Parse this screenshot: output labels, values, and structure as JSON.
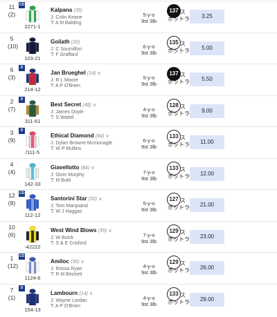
{
  "runners": [
    {
      "number": "11",
      "draw": "(2)",
      "badge": "CD",
      "form": "2271-1",
      "name": "Kalpana",
      "rating": "(35)",
      "chev": "",
      "jockey": "J: Colin Keane",
      "trainer": "T: A M Balding",
      "age": "5-y-o",
      "weight": "9st 3lb",
      "rtg": "137",
      "rtg_style": "dark",
      "spot_a": "ス",
      "spot_b": "ポットライト",
      "odds": "3.25",
      "silk": {
        "body": "#2fa84f",
        "sleeves": "#ffffff",
        "cap": "#2fa84f",
        "stripe": "#ffffff"
      }
    },
    {
      "number": "5",
      "draw": "(10)",
      "badge": "",
      "form": "103-21",
      "name": "Goliath",
      "rating": "(20)",
      "chev": "",
      "jockey": "J: C Soumillon",
      "trainer": "T: F Graffard",
      "age": "6-y-o",
      "weight": "9st 3lb",
      "rtg": "135",
      "rtg_style": "light",
      "spot_a": "ス",
      "spot_b": "ポットライト",
      "odds": "5.00",
      "silk": {
        "body": "#14193a",
        "sleeves": "#14193a",
        "cap": "#14193a",
        "stripe": "#14193a"
      }
    },
    {
      "number": "6",
      "draw": "(3)",
      "badge": "D",
      "form": "214-12",
      "name": "Jan Brueghel",
      "rating": "(14)",
      "chev": "∨",
      "jockey": "J: R L Moore",
      "trainer": "T: A P O'Brien",
      "age": "5-y-o",
      "weight": "9st 3lb",
      "rtg": "137",
      "rtg_style": "dark",
      "spot_a": "ス",
      "spot_b": "ポットライト",
      "odds": "5.50",
      "silk": {
        "body": "#c22a3a",
        "sleeves": "#1c2f7a",
        "cap": "#1c2f7a",
        "stripe": "#c22a3a"
      }
    },
    {
      "number": "2",
      "draw": "(7)",
      "badge": "D",
      "form": "311-61",
      "name": "Best Secret",
      "rating": "(48)",
      "chev": "∨",
      "jockey": "J: James Doyle",
      "trainer": "T: S Wattel",
      "age": "4-y-o",
      "weight": "9st 3lb",
      "rtg": "128",
      "rtg_style": "light",
      "spot_a": "ス",
      "spot_b": "ポットライト",
      "odds": "9.00",
      "silk": {
        "body": "#2b5b3a",
        "sleeves": "#b9892e",
        "cap": "#2b5b3a",
        "stripe": "#2b5b3a"
      }
    },
    {
      "number": "3",
      "draw": "(9)",
      "badge": "D",
      "form": "/111-5",
      "name": "Ethical Diamond",
      "rating": "(84)",
      "chev": "∨",
      "jockey": "J: Dylan Browne Mcmonagle",
      "trainer": "T: W P Mullins",
      "age": "6-y-o",
      "weight": "9st 3lb",
      "rtg": "133",
      "rtg_style": "light",
      "spot_a": "ス",
      "spot_b": "ポットライト",
      "odds": "11.00",
      "silk": {
        "body": "#f2c7d4",
        "sleeves": "#ffffff",
        "cap": "#e24a6a",
        "stripe": "#e24a6a"
      }
    },
    {
      "number": "4",
      "draw": "(4)",
      "badge": "",
      "form": "142-33",
      "name": "Giavellotto",
      "rating": "(84)",
      "chev": "∨",
      "jockey": "J: Oisin Murphy",
      "trainer": "T: M Botti",
      "age": "7-y-o",
      "weight": "9st 3lb",
      "rtg": "133",
      "rtg_style": "light",
      "spot_a": "ス",
      "spot_b": "ポットライト",
      "odds": "12.00",
      "silk": {
        "body": "#e8f2f6",
        "sleeves": "#e8f2f6",
        "cap": "#44b8d6",
        "stripe": "#44b8d6"
      }
    },
    {
      "number": "12",
      "draw": "(8)",
      "badge": "CD",
      "form": "112-12",
      "name": "Santorini Star",
      "rating": "(30)",
      "chev": "∨",
      "jockey": "J: Tom Marquand",
      "trainer": "T: W J Haggas",
      "age": "5-y-o",
      "weight": "9st 3lb",
      "rtg": "127",
      "rtg_style": "light",
      "spot_a": "ス",
      "spot_b": "ポットライト",
      "odds": "21.00",
      "silk": {
        "body": "#2f58c9",
        "sleeves": "#2f58c9",
        "cap": "#2f58c9",
        "stripe": "#8fb0ee"
      }
    },
    {
      "number": "10",
      "draw": "(6)",
      "badge": "",
      "form": "-42222",
      "name": "West Wind Blows",
      "rating": "(35)",
      "chev": "∨",
      "jockey": "J: W Buick",
      "trainer": "T: S & E Crisford",
      "age": "7-y-o",
      "weight": "9st 3lb",
      "rtg": "129",
      "rtg_style": "light",
      "spot_a": "ス",
      "spot_b": "ポットライト",
      "odds": "23.00",
      "silk": {
        "body": "#f2e21a",
        "sleeves": "#1a1a1a",
        "cap": "#f2e21a",
        "stripe": "#1a1a1a"
      }
    },
    {
      "number": "1",
      "draw": "(12)",
      "badge": "CD",
      "form": "1124-6",
      "name": "Amiloc",
      "rating": "(36)",
      "chev": "∨",
      "jockey": "J: Rossa Ryan",
      "trainer": "T: R M Beckett",
      "age": "4-y-o",
      "weight": "9st 3lb",
      "rtg": "129",
      "rtg_style": "light",
      "spot_a": "ス",
      "spot_b": "ポットライト",
      "odds": "26.00",
      "silk": {
        "body": "#7a8fd0",
        "sleeves": "#ffffff",
        "cap": "#3e56b3",
        "stripe": "#ffffff"
      }
    },
    {
      "number": "7",
      "draw": "(1)",
      "badge": "D",
      "form": "154-13",
      "name": "Lambourn",
      "rating": "(14)",
      "chev": "∨",
      "jockey": "J: Wayne Lordan",
      "trainer": "T: A P O'Brien",
      "age": "4-y-o",
      "weight": "9st 3lb",
      "rtg": "133",
      "rtg_style": "light",
      "spot_a": "ス",
      "spot_b": "ポットライト",
      "odds": "29.00",
      "silk": {
        "body": "#1c2f7a",
        "sleeves": "#1c2f7a",
        "cap": "#1c2f7a",
        "stripe": "#1c2f7a"
      }
    }
  ]
}
